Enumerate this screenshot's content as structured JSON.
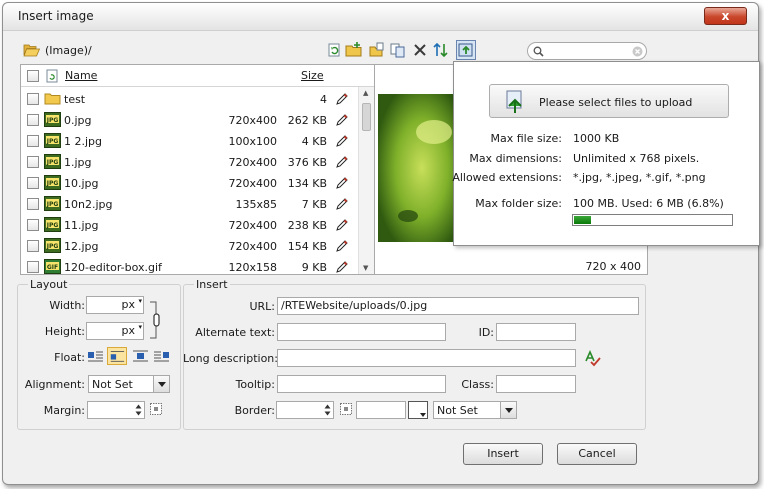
{
  "window": {
    "title": "Insert image",
    "close_label": "x"
  },
  "path": {
    "text": "(Image)/"
  },
  "toolbar": {
    "icons": [
      "refresh-icon",
      "new-folder-icon",
      "cut-icon",
      "copy-icon",
      "delete-icon",
      "sort-icon",
      "upload-icon"
    ]
  },
  "search": {
    "value": "",
    "placeholder": ""
  },
  "filelist": {
    "columns": {
      "name": "Name",
      "size": "Size"
    },
    "rows": [
      {
        "name": "test",
        "dims": "",
        "size": "4",
        "type": "folder"
      },
      {
        "name": "0.jpg",
        "dims": "720x400",
        "size": "262 KB",
        "type": "jpg"
      },
      {
        "name": "1 2.jpg",
        "dims": "100x100",
        "size": "4 KB",
        "type": "jpg"
      },
      {
        "name": "1.jpg",
        "dims": "720x400",
        "size": "376 KB",
        "type": "jpg"
      },
      {
        "name": "10.jpg",
        "dims": "720x400",
        "size": "134 KB",
        "type": "jpg"
      },
      {
        "name": "10n2.jpg",
        "dims": "135x85",
        "size": "7 KB",
        "type": "jpg"
      },
      {
        "name": "11.jpg",
        "dims": "720x400",
        "size": "238 KB",
        "type": "jpg"
      },
      {
        "name": "12.jpg",
        "dims": "720x400",
        "size": "154 KB",
        "type": "jpg"
      },
      {
        "name": "120-editor-box.gif",
        "dims": "120x158",
        "size": "9 KB",
        "type": "gif"
      }
    ]
  },
  "preview": {
    "dims": "720 x 400"
  },
  "upload": {
    "button_label": "Please select files to upload",
    "max_file_size_label": "Max file size:",
    "max_file_size_value": "1000 KB",
    "max_dimensions_label": "Max dimensions:",
    "max_dimensions_value": "Unlimited x 768 pixels.",
    "allowed_ext_label": "Allowed extensions:",
    "allowed_ext_value": "*.jpg, *.jpeg, *.gif, *.png",
    "max_folder_label": "Max folder size:",
    "max_folder_value": "100 MB. Used: 6 MB (6.8%)",
    "used_fraction": 0.068
  },
  "layout": {
    "legend": "Layout",
    "width_label": "Width:",
    "width_value": "",
    "width_unit": "px",
    "height_label": "Height:",
    "height_value": "",
    "height_unit": "px",
    "float_label": "Float:",
    "alignment_label": "Alignment:",
    "alignment_value": "Not Set",
    "margin_label": "Margin:",
    "margin_value": ""
  },
  "insert": {
    "legend": "Insert",
    "url_label": "URL:",
    "url_value": "/RTEWebsite/uploads/0.jpg",
    "alt_label": "Alternate text:",
    "alt_value": "",
    "id_label": "ID:",
    "id_value": "",
    "longdesc_label": "Long description:",
    "longdesc_value": "",
    "tooltip_label": "Tooltip:",
    "tooltip_value": "",
    "class_label": "Class:",
    "class_value": "",
    "border_label": "Border:",
    "border_value": "",
    "border_color_value": "",
    "border_style_value": "Not Set"
  },
  "buttons": {
    "insert": "Insert",
    "cancel": "Cancel"
  },
  "colors": {
    "progress": "#0a7a0a",
    "close": "#c2351a"
  }
}
